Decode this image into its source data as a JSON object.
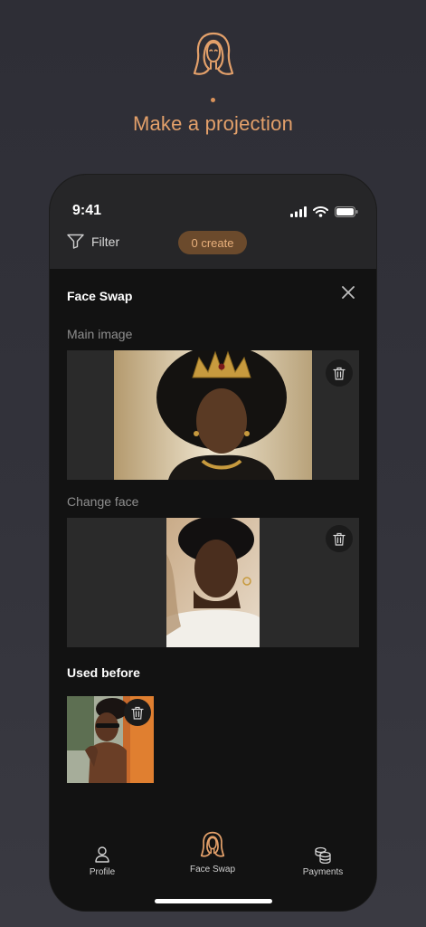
{
  "header": {
    "logo_icon": "face-silhouette-logo-icon",
    "headline": "Make a projection"
  },
  "status_bar": {
    "time": "9:41",
    "icons": [
      "signal-icon",
      "wifi-icon",
      "battery-icon"
    ]
  },
  "toolbar": {
    "filter_label": "Filter",
    "create_label": "0 create"
  },
  "sheet": {
    "title": "Face Swap",
    "main_image_label": "Main image",
    "change_face_label": "Change face",
    "used_before_label": "Used before"
  },
  "tabs": [
    {
      "label": "Profile",
      "icon": "person-icon"
    },
    {
      "label": "Face Swap",
      "icon": "face-swap-icon",
      "active": true
    },
    {
      "label": "Payments",
      "icon": "coins-icon"
    }
  ],
  "colors": {
    "accent": "#e3a06a",
    "pill_bg": "#6b4a2c",
    "background": "#121212"
  }
}
